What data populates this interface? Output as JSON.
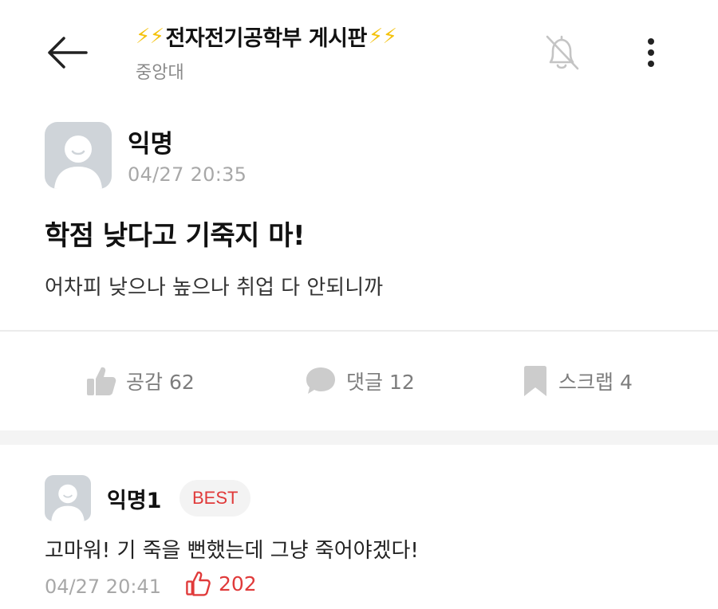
{
  "header": {
    "title_prefix": "⚡⚡",
    "title": "전자전기공학부 게시판",
    "title_suffix": "⚡⚡",
    "subtitle": "중앙대"
  },
  "post": {
    "author": "익명",
    "time": "04/27 20:35",
    "title": "학점 낮다고 기죽지 마!",
    "body": "어차피 낮으나 높으나 취업 다 안되니까"
  },
  "actions": {
    "like_label": "공감 62",
    "comment_label": "댓글 12",
    "scrap_label": "스크랩 4"
  },
  "comment": {
    "author": "익명1",
    "badge": "BEST",
    "body": "고마워! 기 죽을 뻔했는데 그냥 죽어야겠다!",
    "time": "04/27 20:41",
    "likes": "202"
  },
  "colors": {
    "accent_red": "#e03a3a",
    "bolt_yellow": "#f4c20d",
    "muted_gray": "#a8a8a8"
  }
}
